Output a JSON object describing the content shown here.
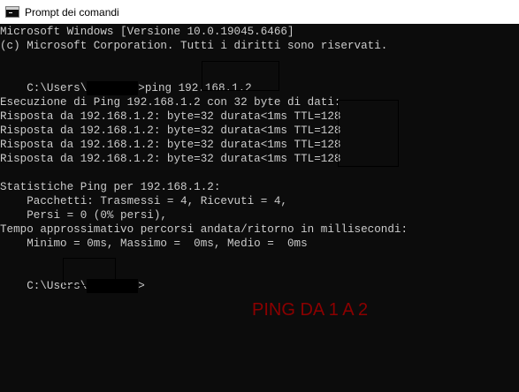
{
  "window": {
    "title": "Prompt dei comandi",
    "icon": "cmd-icon"
  },
  "console": {
    "header_1": "Microsoft Windows [Versione 10.0.19045.6466]",
    "header_2": "(c) Microsoft Corporation. Tutti i diritti sono riservati.",
    "prompt_1_prefix": "C:\\Users\\",
    "prompt_1_suffix": ">ping 192.168.1.2",
    "exec_line": "Esecuzione di Ping 192.168.1.2 con 32 byte di dati:",
    "replies": [
      "Risposta da 192.168.1.2: byte=32 durata<1ms TTL=128",
      "Risposta da 192.168.1.2: byte=32 durata<1ms TTL=128",
      "Risposta da 192.168.1.2: byte=32 durata<1ms TTL=128",
      "Risposta da 192.168.1.2: byte=32 durata<1ms TTL=128"
    ],
    "stats_title": "Statistiche Ping per 192.168.1.2:",
    "stats_packets": "    Pacchetti: Trasmessi = 4, Ricevuti = 4,",
    "stats_lost": "    Persi = 0 (0% persi),",
    "rtt_title": "Tempo approssimativo percorsi andata/ritorno in millisecondi:",
    "rtt_values": "    Minimo = 0ms, Massimo =  0ms, Medio =  0ms",
    "prompt_2_prefix": "C:\\Users\\",
    "prompt_2_suffix": ">"
  },
  "annotation": {
    "text": "PING DA 1 A 2",
    "color": "#8b0000"
  },
  "colors": {
    "console_bg": "#0c0c0c",
    "console_text": "#cccccc",
    "titlebar_bg": "#ffffff"
  }
}
